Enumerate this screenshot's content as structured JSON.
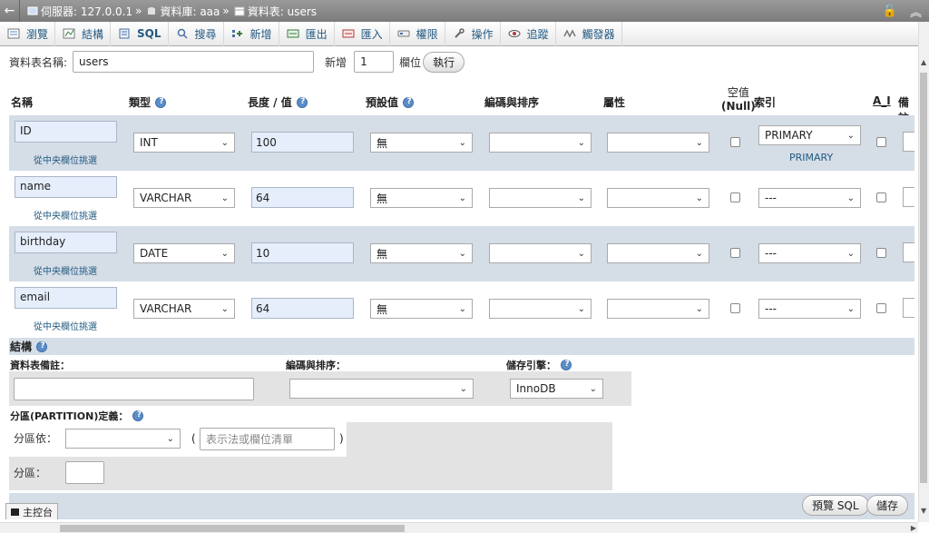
{
  "breadcrumb": {
    "back": "←",
    "server": "伺服器: 127.0.0.1",
    "database": "資料庫: aaa",
    "table": "資料表: users",
    "sep": "»",
    "lock_glyph": "🔓",
    "collapse_glyph": "︽"
  },
  "tabs": [
    {
      "label": "瀏覽",
      "icon": "browse-icon"
    },
    {
      "label": "結構",
      "icon": "structure-icon"
    },
    {
      "label": "SQL",
      "icon": "sql-icon"
    },
    {
      "label": "搜尋",
      "icon": "search-icon"
    },
    {
      "label": "新增",
      "icon": "insert-icon"
    },
    {
      "label": "匯出",
      "icon": "export-icon"
    },
    {
      "label": "匯入",
      "icon": "import-icon"
    },
    {
      "label": "權限",
      "icon": "privileges-icon"
    },
    {
      "label": "操作",
      "icon": "wrench-icon"
    },
    {
      "label": "追蹤",
      "icon": "eye-icon"
    },
    {
      "label": "觸發器",
      "icon": "trigger-icon"
    }
  ],
  "form": {
    "table_name_label": "資料表名稱:",
    "table_name_value": "users",
    "add_label": "新增",
    "add_count": "1",
    "column_label": "欄位",
    "go_button": "執行"
  },
  "columns_header": {
    "name": "名稱",
    "type": "類型",
    "length": "長度 / 值",
    "default": "預設值",
    "collation": "編碼與排序",
    "attributes": "屬性",
    "null_line1": "空值",
    "null_line2": "(Null)",
    "index": "索引",
    "ai": "A_I",
    "comment": "備註"
  },
  "pick_text": "從中央欄位挑選",
  "fields": [
    {
      "name": "ID",
      "type": "INT",
      "length": "100",
      "default": "無",
      "index": "PRIMARY",
      "index_note": "PRIMARY"
    },
    {
      "name": "name",
      "type": "VARCHAR",
      "length": "64",
      "default": "無",
      "index": "---",
      "index_note": ""
    },
    {
      "name": "birthday",
      "type": "DATE",
      "length": "10",
      "default": "無",
      "index": "---",
      "index_note": ""
    },
    {
      "name": "email",
      "type": "VARCHAR",
      "length": "64",
      "default": "無",
      "index": "---",
      "index_note": ""
    }
  ],
  "structure": {
    "title": "結構",
    "comment_label": "資料表備註：",
    "collation_label": "編碼與排序：",
    "engine_label": "儲存引擎：",
    "engine_value": "InnoDB"
  },
  "partition": {
    "title": "分區(PARTITION)定義：",
    "by_label": "分區依：",
    "open_paren": "(",
    "close_paren": ")",
    "expr_placeholder": "表示法或欄位清單",
    "partitions_label": "分區："
  },
  "footer": {
    "preview_sql": "預覽 SQL",
    "save": "儲存",
    "console": "主控台"
  }
}
